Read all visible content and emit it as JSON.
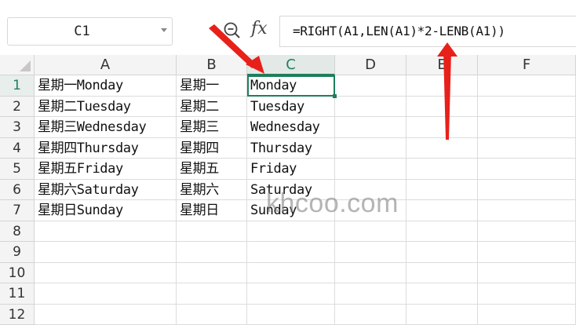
{
  "namebox": {
    "value": "C1"
  },
  "formula": {
    "text": "=RIGHT(A1,LEN(A1)*2-LENB(A1))"
  },
  "icons": {
    "zoom": "zoom-icon",
    "fx": "fx",
    "dropdown": "chevron-down-icon"
  },
  "columns": [
    "A",
    "B",
    "C",
    "D",
    "E",
    "F"
  ],
  "rows": [
    "1",
    "2",
    "3",
    "4",
    "5",
    "6",
    "7",
    "8",
    "9",
    "10",
    "11",
    "12"
  ],
  "cells": [
    {
      "a": "星期一Monday",
      "b": "星期一",
      "c": "Monday"
    },
    {
      "a": "星期二Tuesday",
      "b": "星期二",
      "c": "Tuesday"
    },
    {
      "a": "星期三Wednesday",
      "b": "星期三",
      "c": "Wednesday"
    },
    {
      "a": "星期四Thursday",
      "b": "星期四",
      "c": "Thursday"
    },
    {
      "a": "星期五Friday",
      "b": "星期五",
      "c": "Friday"
    },
    {
      "a": "星期六Saturday",
      "b": "星期六",
      "c": "Saturday"
    },
    {
      "a": "星期日Sunday",
      "b": "星期日",
      "c": "Sunday"
    }
  ],
  "watermark": "khcoo.com",
  "colors": {
    "accent": "#1e7f5a",
    "arrow": "#e8201a"
  }
}
